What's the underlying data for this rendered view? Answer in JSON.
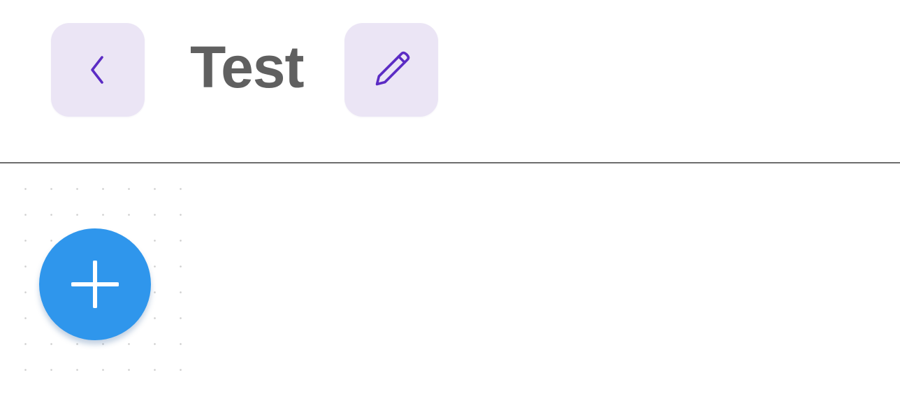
{
  "header": {
    "title": "Test",
    "back_icon": "chevron-left-icon",
    "edit_icon": "pencil-icon"
  },
  "fab": {
    "icon": "plus-icon"
  },
  "colors": {
    "icon_button_background": "#ebe5f5",
    "icon_color": "#5b2bc4",
    "title_color": "#606060",
    "divider": "#6d6d6d",
    "fab_background": "#2f96ec",
    "fab_icon": "#ffffff"
  }
}
